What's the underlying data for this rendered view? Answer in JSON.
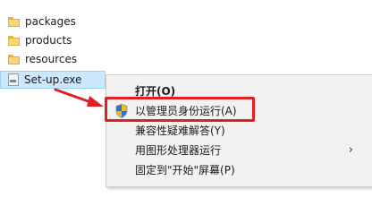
{
  "files": [
    {
      "name": "packages",
      "type": "folder"
    },
    {
      "name": "products",
      "type": "folder"
    },
    {
      "name": "resources",
      "type": "folder"
    },
    {
      "name": "Set-up.exe",
      "type": "exe",
      "selected": true
    }
  ],
  "context_menu": {
    "items": [
      {
        "label": "打开(O)",
        "bold": true
      },
      {
        "label": "以管理员身份运行(A)",
        "icon": "uac-shield-icon",
        "highlighted": true
      },
      {
        "label": "兼容性疑难解答(Y)"
      },
      {
        "label": "用图形处理器运行",
        "submenu": true
      },
      {
        "label": "固定到\"开始\"屏幕(P)"
      }
    ],
    "submenu_arrow": "›"
  },
  "annotation": {
    "color": "#e02020"
  }
}
